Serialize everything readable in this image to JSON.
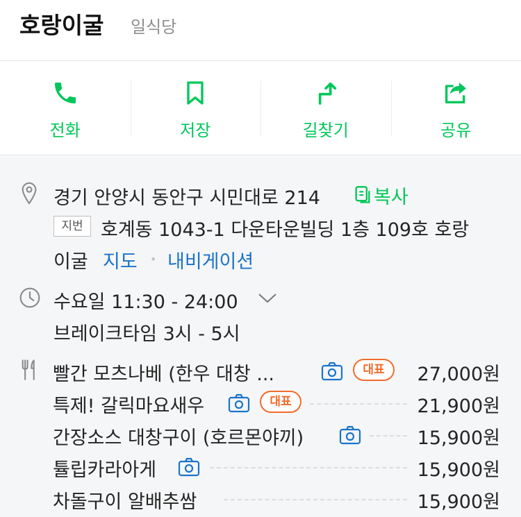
{
  "header": {
    "name": "호랑이굴",
    "category": "일식당"
  },
  "actions": [
    {
      "label": "전화",
      "icon": "phone-icon"
    },
    {
      "label": "저장",
      "icon": "bookmark-icon"
    },
    {
      "label": "길찾기",
      "icon": "directions-icon"
    },
    {
      "label": "공유",
      "icon": "share-icon"
    }
  ],
  "colors": {
    "accent": "#03c75a",
    "link": "#1a73c9",
    "badge": "#f26b2b"
  },
  "address": {
    "road": "경기 안양시 동안구 시민대로 214",
    "copy_label": "복사",
    "lot_label": "지번",
    "lot_line1": "호계동 1043-1 다운타운빌딩 1층 109호 호랑",
    "lot_line2": "이굴",
    "map_link": "지도",
    "navi_link": "내비게이션"
  },
  "hours": {
    "today": "수요일 11:30 - 24:00",
    "break": "브레이크타임 3시 - 5시"
  },
  "menu": [
    {
      "name": "빨간 모츠나베 (한우 대창 ...",
      "price": "27,000원",
      "badge": "대표"
    },
    {
      "name": "특제! 갈릭마요새우",
      "price": "21,900원",
      "badge": "대표"
    },
    {
      "name": "간장소스 대창구이 (호르몬야끼)",
      "price": "15,900원"
    },
    {
      "name": "튤립카라아게",
      "price": "15,900원"
    },
    {
      "name": "차돌구이 알배추쌈",
      "price": "15,900원"
    }
  ]
}
